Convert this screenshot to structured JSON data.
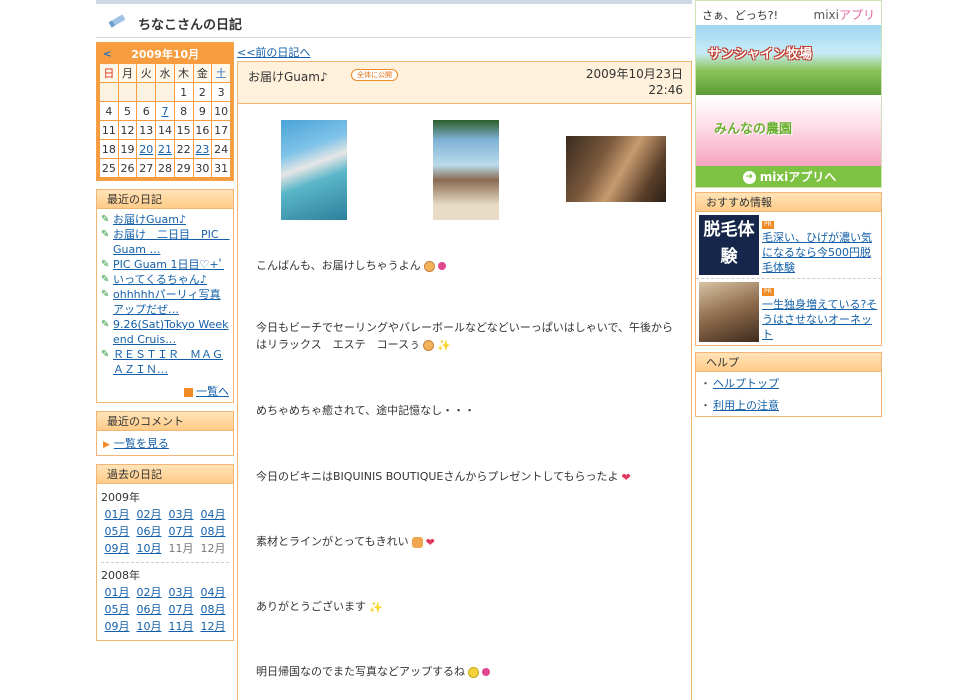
{
  "header": {
    "title": "ちなこさんの日記"
  },
  "calendar": {
    "prev": "<",
    "title": "2009年10月",
    "dow": [
      "日",
      "月",
      "火",
      "水",
      "木",
      "金",
      "土"
    ],
    "weeks": [
      [
        "",
        "",
        "",
        "",
        "1",
        "2",
        "3"
      ],
      [
        "4",
        "5",
        "6",
        "7",
        "8",
        "9",
        "10"
      ],
      [
        "11",
        "12",
        "13",
        "14",
        "15",
        "16",
        "17"
      ],
      [
        "18",
        "19",
        "20",
        "21",
        "22",
        "23",
        "24"
      ],
      [
        "25",
        "26",
        "27",
        "28",
        "29",
        "30",
        "31"
      ]
    ],
    "linked_days": [
      "7",
      "20",
      "21",
      "23"
    ]
  },
  "recent": {
    "title": "最近の日記",
    "items": [
      "お届けGuam♪",
      "お届け　二日目　PIC　Guam …",
      "PIC Guam 1日目♡+ﾟ",
      "いってくるちゃん♪",
      "ohhhhhパーリィ写真アップだぜ…",
      "9.26(Sat)Tokyo Weekend Cruis…",
      "ＲＥＳＴＩＲ　ＭＡＧＡＺＩＮ…"
    ],
    "more": "一覧へ"
  },
  "comments": {
    "title": "最近のコメント",
    "link": "一覧を見る"
  },
  "past": {
    "title": "過去の日記",
    "years": [
      {
        "year": "2009年",
        "months": [
          "01月",
          "02月",
          "03月",
          "04月",
          "05月",
          "06月",
          "07月",
          "08月",
          "09月",
          "10月",
          "11月",
          "12月"
        ]
      },
      {
        "year": "2008年",
        "months": [
          "01月",
          "02月",
          "03月",
          "04月",
          "05月",
          "06月",
          "07月",
          "08月",
          "09月",
          "10月",
          "11月",
          "12月"
        ]
      }
    ]
  },
  "main": {
    "prev_link": "<<前の日記へ",
    "entry": {
      "title": "お届けGuam♪",
      "badge": "全体に公開",
      "date": "2009年10月23日",
      "time": "22:46",
      "paragraphs": [
        "こんばんも、お届けしちゃうよん",
        "今日もビーチでセーリングやバレーボールなどなどいーっぱいはしゃいで、午後からはリラックス　エステ　コースぅ",
        "めちゃめちゃ癒されて、途中記憶なし・・・",
        "今日のビキニはBIQUINIS BOUTIQUEさんからプレゼントしてもらったよ",
        "素材とラインがとってもきれい",
        "ありがとうございます",
        "明日帰国なのでまた写真などアップするね"
      ]
    }
  },
  "right": {
    "app": {
      "tag": "さぁ、どっち?!",
      "logo_a": "mixi",
      "logo_b": "アプリ",
      "game1": "サンシャイン牧場",
      "game2": "みんなの農園",
      "link": "mixiアプリへ"
    },
    "reco": {
      "title": "おすすめ情報",
      "ad1_img": "脱毛体験",
      "items": [
        {
          "text": "毛深い、ひげが濃い気になるなら今500円脱毛体験"
        },
        {
          "text": "一生独身増えている?そうはさせないオーネット"
        }
      ],
      "pr": "PR"
    },
    "help": {
      "title": "ヘルプ",
      "items": [
        "ヘルプトップ",
        "利用上の注意"
      ]
    }
  },
  "colors": {
    "accent": "#f3b574",
    "link": "#1560a8",
    "green": "#7dc242"
  }
}
